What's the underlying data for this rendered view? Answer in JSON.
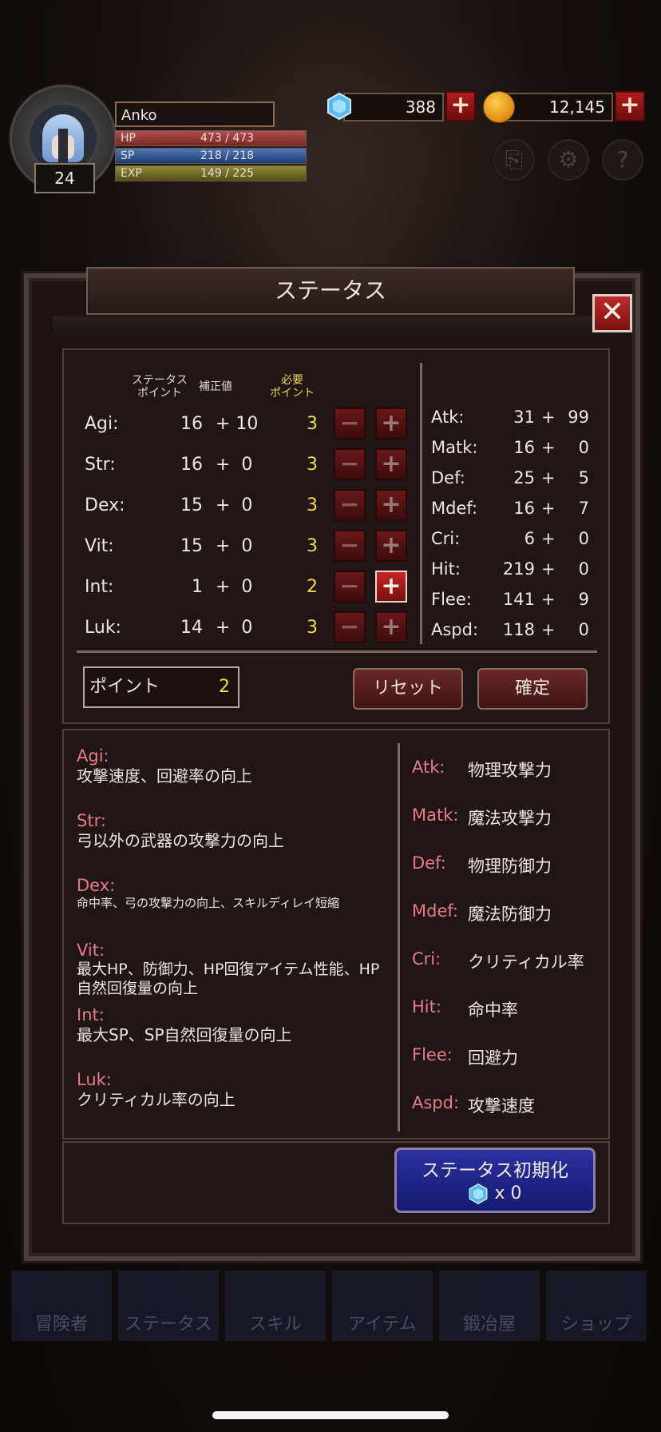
{
  "player": {
    "name": "Anko",
    "level": "24",
    "hp_label": "HP",
    "hp_value": "473 / 473",
    "sp_label": "SP",
    "sp_value": "218 / 218",
    "exp_label": "EXP",
    "exp_value": "149 / 225"
  },
  "currency": {
    "gems": "388",
    "gold": "12,145"
  },
  "dialog": {
    "title": "ステータス",
    "col_points": "ステータス\nポイント",
    "col_bonus": "補正値",
    "col_required": "必要\nポイント"
  },
  "stats": [
    {
      "name": "Agi:",
      "points": "16",
      "bonus": "+ 10",
      "required": "3"
    },
    {
      "name": "Str:",
      "points": "16",
      "bonus": "+  0",
      "required": "3"
    },
    {
      "name": "Dex:",
      "points": "15",
      "bonus": "+  0",
      "required": "3"
    },
    {
      "name": "Vit:",
      "points": "15",
      "bonus": "+  0",
      "required": "3"
    },
    {
      "name": "Int:",
      "points": "1",
      "bonus": "+  0",
      "required": "2"
    },
    {
      "name": "Luk:",
      "points": "14",
      "bonus": "+  0",
      "required": "3"
    }
  ],
  "derived": [
    {
      "name": "Atk:",
      "base": "31",
      "plus": "+",
      "bonus": "99"
    },
    {
      "name": "Matk:",
      "base": "16",
      "plus": "+",
      "bonus": "0"
    },
    {
      "name": "Def:",
      "base": "25",
      "plus": "+",
      "bonus": "5"
    },
    {
      "name": "Mdef:",
      "base": "16",
      "plus": "+",
      "bonus": "7"
    },
    {
      "name": "Cri:",
      "base": "6",
      "plus": "+",
      "bonus": "0"
    },
    {
      "name": "Hit:",
      "base": "219",
      "plus": "+",
      "bonus": "0"
    },
    {
      "name": "Flee:",
      "base": "141",
      "plus": "+",
      "bonus": "9"
    },
    {
      "name": "Aspd:",
      "base": "118",
      "plus": "+",
      "bonus": "0"
    }
  ],
  "points": {
    "label": "ポイント",
    "value": "2"
  },
  "buttons": {
    "reset": "リセット",
    "confirm": "確定",
    "stat_reset": "ステータス初期化",
    "stat_reset_cost": "x 0"
  },
  "stat_descriptions": [
    {
      "key": "Agi:",
      "text": "攻撃速度、回避率の向上"
    },
    {
      "key": "Str:",
      "text": "弓以外の武器の攻撃力の向上"
    },
    {
      "key": "Dex:",
      "text": "命中率、弓の攻撃力の向上、スキルディレイ短縮"
    },
    {
      "key": "Vit:",
      "text": "最大HP、防御力、HP回復アイテム性能、HP自然回復量の向上"
    },
    {
      "key": "Int:",
      "text": "最大SP、SP自然回復量の向上"
    },
    {
      "key": "Luk:",
      "text": "クリティカル率の向上"
    }
  ],
  "derived_descriptions": [
    {
      "key": "Atk:",
      "text": "物理攻撃力"
    },
    {
      "key": "Matk:",
      "text": "魔法攻撃力"
    },
    {
      "key": "Def:",
      "text": "物理防御力"
    },
    {
      "key": "Mdef:",
      "text": "魔法防御力"
    },
    {
      "key": "Cri:",
      "text": "クリティカル率"
    },
    {
      "key": "Hit:",
      "text": "命中率"
    },
    {
      "key": "Flee:",
      "text": "回避力"
    },
    {
      "key": "Aspd:",
      "text": "攻撃速度"
    }
  ],
  "nav": [
    "冒険者",
    "ステータス",
    "スキル",
    "アイテム",
    "鍛冶屋",
    "ショップ"
  ],
  "colors": {
    "accent_red": "#b21c1c",
    "required_yellow": "#f2dc3d",
    "desc_key_pink": "#e97a8c",
    "reset_blue": "#2b31a0"
  }
}
